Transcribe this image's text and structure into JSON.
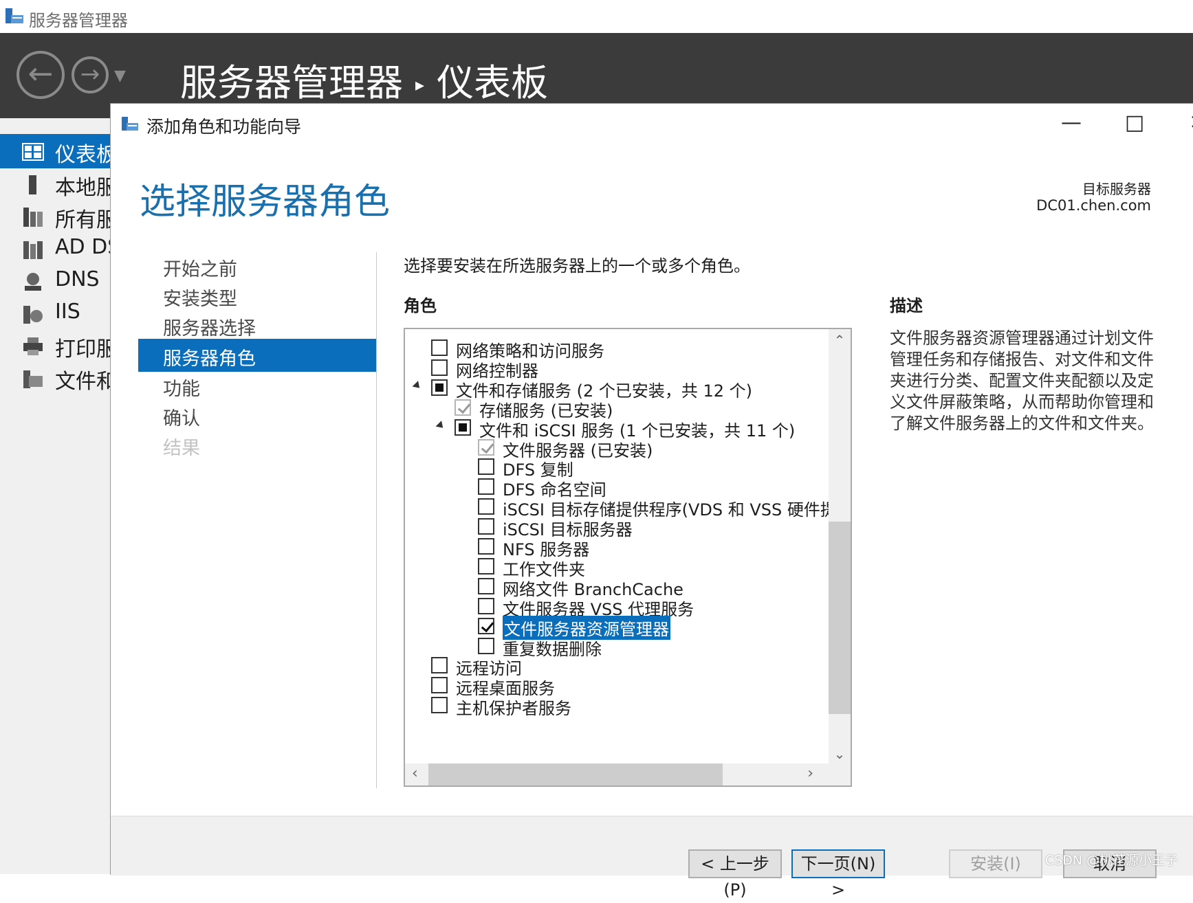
{
  "app": {
    "window_title": "服务器管理器",
    "breadcrumb_root": "服务器管理器",
    "breadcrumb_page": "仪表板"
  },
  "sidebar": {
    "items": [
      {
        "label": "仪表板",
        "icon": "dashboard-icon",
        "active": true
      },
      {
        "label": "本地服务器",
        "icon": "local-server-icon"
      },
      {
        "label": "所有服务器",
        "icon": "all-servers-icon"
      },
      {
        "label": "AD DS",
        "icon": "ad-ds-icon"
      },
      {
        "label": "DNS",
        "icon": "dns-icon"
      },
      {
        "label": "IIS",
        "icon": "iis-icon"
      },
      {
        "label": "打印服务",
        "icon": "printer-icon"
      },
      {
        "label": "文件和存储服务",
        "icon": "file-storage-icon"
      }
    ]
  },
  "wizard": {
    "window_title": "添加角色和功能向导",
    "page_title": "选择服务器角色",
    "target_label": "目标服务器",
    "target_value": "DC01.chen.com",
    "instruction": "选择要安装在所选服务器上的一个或多个角色。",
    "roles_heading": "角色",
    "description_heading": "描述",
    "description": "文件服务器资源管理器通过计划文件管理任务和存储报告、对文件和文件夹进行分类、配置文件夹配额以及定义文件屏蔽策略，从而帮助你管理和了解文件服务器上的文件和文件夹。",
    "steps": [
      {
        "label": "开始之前",
        "state": "normal"
      },
      {
        "label": "安装类型",
        "state": "normal"
      },
      {
        "label": "服务器选择",
        "state": "normal"
      },
      {
        "label": "服务器角色",
        "state": "active"
      },
      {
        "label": "功能",
        "state": "normal"
      },
      {
        "label": "确认",
        "state": "normal"
      },
      {
        "label": "结果",
        "state": "disabled"
      }
    ],
    "roles": [
      {
        "label": "网络策略和访问服务",
        "level": 0,
        "state": "unchecked"
      },
      {
        "label": "网络控制器",
        "level": 0,
        "state": "unchecked"
      },
      {
        "label": "文件和存储服务 (2 个已安装，共 12 个)",
        "level": 0,
        "state": "partial",
        "expander": true
      },
      {
        "label": "存储服务 (已安装)",
        "level": 1,
        "state": "checked-disabled"
      },
      {
        "label": "文件和 iSCSI 服务 (1 个已安装，共 11 个)",
        "level": 1,
        "state": "partial",
        "expander": true
      },
      {
        "label": "文件服务器 (已安装)",
        "level": 2,
        "state": "checked-disabled"
      },
      {
        "label": "DFS 复制",
        "level": 2,
        "state": "unchecked"
      },
      {
        "label": "DFS 命名空间",
        "level": 2,
        "state": "unchecked"
      },
      {
        "label": "iSCSI 目标存储提供程序(VDS 和 VSS 硬件提",
        "level": 2,
        "state": "unchecked"
      },
      {
        "label": "iSCSI 目标服务器",
        "level": 2,
        "state": "unchecked"
      },
      {
        "label": "NFS 服务器",
        "level": 2,
        "state": "unchecked"
      },
      {
        "label": "工作文件夹",
        "level": 2,
        "state": "unchecked"
      },
      {
        "label": "网络文件 BranchCache",
        "level": 2,
        "state": "unchecked"
      },
      {
        "label": "文件服务器 VSS 代理服务",
        "level": 2,
        "state": "unchecked"
      },
      {
        "label": "文件服务器资源管理器",
        "level": 2,
        "state": "checked",
        "selected": true
      },
      {
        "label": "重复数据删除",
        "level": 2,
        "state": "unchecked"
      },
      {
        "label": "远程访问",
        "level": 0,
        "state": "unchecked"
      },
      {
        "label": "远程桌面服务",
        "level": 0,
        "state": "unchecked"
      },
      {
        "label": "主机保护者服务",
        "level": 0,
        "state": "unchecked"
      }
    ],
    "buttons": {
      "prev": "< 上一步(P)",
      "next": "下一页(N) >",
      "install": "安装(I)",
      "cancel": "取消"
    }
  },
  "watermark": "CSDN @桃花源小王子",
  "colors": {
    "accent": "#0a6ebd",
    "title_blue": "#1a6fad",
    "header_dark": "#3b3b3b"
  }
}
